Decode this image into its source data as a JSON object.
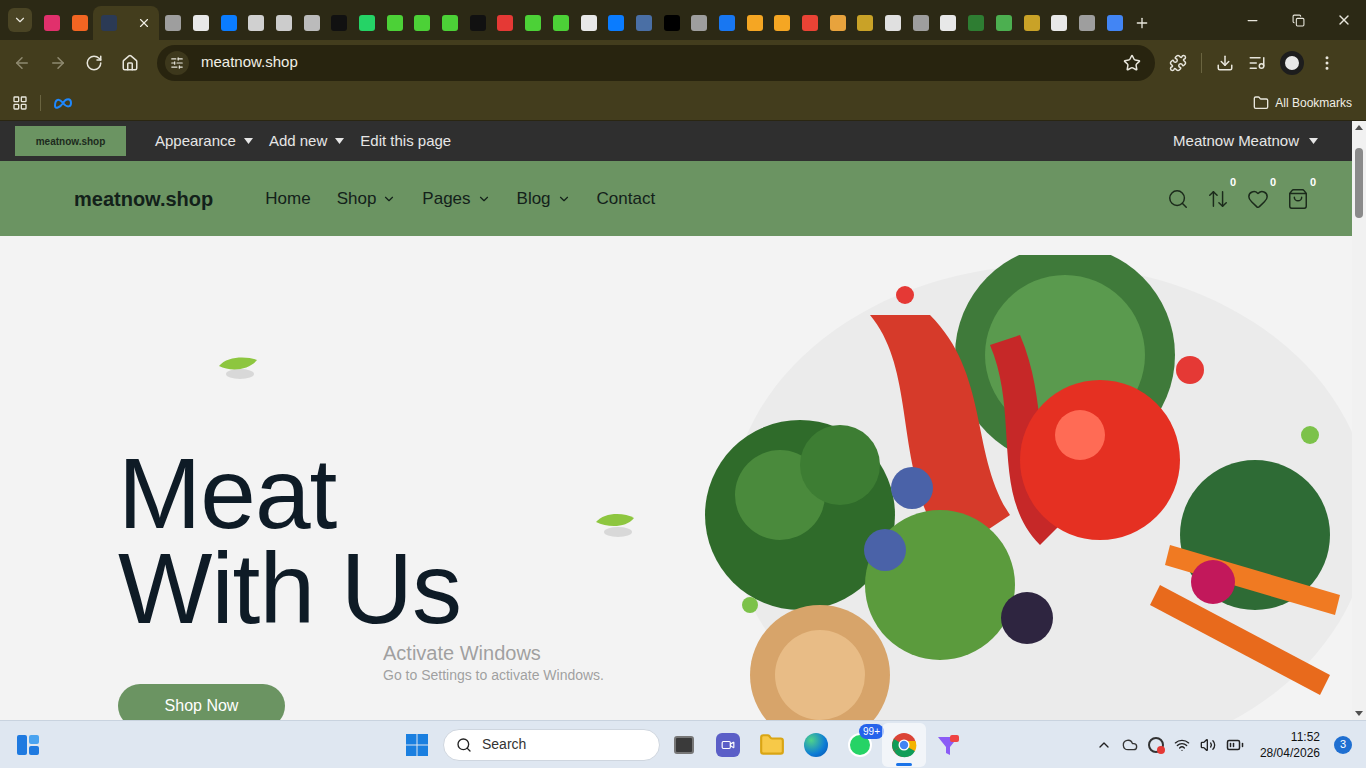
{
  "browser": {
    "tabs": [
      {
        "selected": false,
        "color": "#e1306c"
      },
      {
        "selected": false,
        "color": "#f26522"
      },
      {
        "selected": true,
        "color": "#2b3a55"
      },
      {
        "selected": false,
        "color": "#9e9e9e"
      },
      {
        "selected": false,
        "color": "#e8e8e8"
      },
      {
        "selected": false,
        "color": "#0a7cff"
      },
      {
        "selected": false,
        "color": "#d0d0d0"
      },
      {
        "selected": false,
        "color": "#cccccc"
      },
      {
        "selected": false,
        "color": "#bbbbbb"
      },
      {
        "selected": false,
        "color": "#111111"
      },
      {
        "selected": false,
        "color": "#25d366"
      },
      {
        "selected": false,
        "color": "#4cd137"
      },
      {
        "selected": false,
        "color": "#4cd137"
      },
      {
        "selected": false,
        "color": "#4cd137"
      },
      {
        "selected": false,
        "color": "#111111"
      },
      {
        "selected": false,
        "color": "#e53935"
      },
      {
        "selected": false,
        "color": "#4cd137"
      },
      {
        "selected": false,
        "color": "#4cd137"
      },
      {
        "selected": false,
        "color": "#e8e8e8"
      },
      {
        "selected": false,
        "color": "#0a7cff"
      },
      {
        "selected": false,
        "color": "#4a6fa5"
      },
      {
        "selected": false,
        "color": "#000000"
      },
      {
        "selected": false,
        "color": "#9e9e9e"
      },
      {
        "selected": false,
        "color": "#1877f2"
      },
      {
        "selected": false,
        "color": "#f5a623"
      },
      {
        "selected": false,
        "color": "#f5a623"
      },
      {
        "selected": false,
        "color": "#ea4335"
      },
      {
        "selected": false,
        "color": "#e8a33d"
      },
      {
        "selected": false,
        "color": "#c9a227"
      },
      {
        "selected": false,
        "color": "#e0e0e0"
      },
      {
        "selected": false,
        "color": "#9e9e9e"
      },
      {
        "selected": false,
        "color": "#e8e8e8"
      },
      {
        "selected": false,
        "color": "#2e7d32"
      },
      {
        "selected": false,
        "color": "#4caf50"
      },
      {
        "selected": false,
        "color": "#c9a227"
      },
      {
        "selected": false,
        "color": "#e8e8e8"
      },
      {
        "selected": false,
        "color": "#9e9e9e"
      },
      {
        "selected": false,
        "color": "#4285f4"
      }
    ],
    "address": "meatnow.shop",
    "bookmarks": {
      "label": "All Bookmarks"
    }
  },
  "admin_bar": {
    "site": "meatnow.shop",
    "menus": [
      {
        "label": "Appearance",
        "dropdown": true
      },
      {
        "label": "Add new",
        "dropdown": true
      },
      {
        "label": "Edit this page",
        "dropdown": false
      }
    ],
    "user": "Meatnow Meatnow"
  },
  "header": {
    "logo": "meatnow.shop",
    "nav": [
      {
        "label": "Home",
        "dropdown": false
      },
      {
        "label": "Shop",
        "dropdown": true
      },
      {
        "label": "Pages",
        "dropdown": true
      },
      {
        "label": "Blog",
        "dropdown": true
      },
      {
        "label": "Contact",
        "dropdown": false
      }
    ],
    "counters": [
      {
        "kind": "compare",
        "count": "0"
      },
      {
        "kind": "wishlist",
        "count": "0"
      },
      {
        "kind": "cart",
        "count": "0"
      }
    ]
  },
  "hero": {
    "title_lines": [
      "Meat",
      "With Us"
    ],
    "button": "Shop Now"
  },
  "watermark": {
    "title": "Activate Windows",
    "subtitle": "Go to Settings to activate Windows."
  },
  "taskbar": {
    "search": "Search",
    "apps": [
      {
        "kind": "taskview",
        "badge": "",
        "active": false
      },
      {
        "kind": "meet",
        "badge": "",
        "active": false
      },
      {
        "kind": "explorer",
        "badge": "",
        "active": false
      },
      {
        "kind": "edge",
        "badge": "",
        "active": false
      },
      {
        "kind": "whatsapp",
        "badge": "99+",
        "active": false
      },
      {
        "kind": "chrome",
        "badge": "",
        "active": true
      },
      {
        "kind": "app",
        "badge": "",
        "active": false
      }
    ],
    "time": "11:52",
    "date": "28/04/2026",
    "notifications": "3"
  }
}
